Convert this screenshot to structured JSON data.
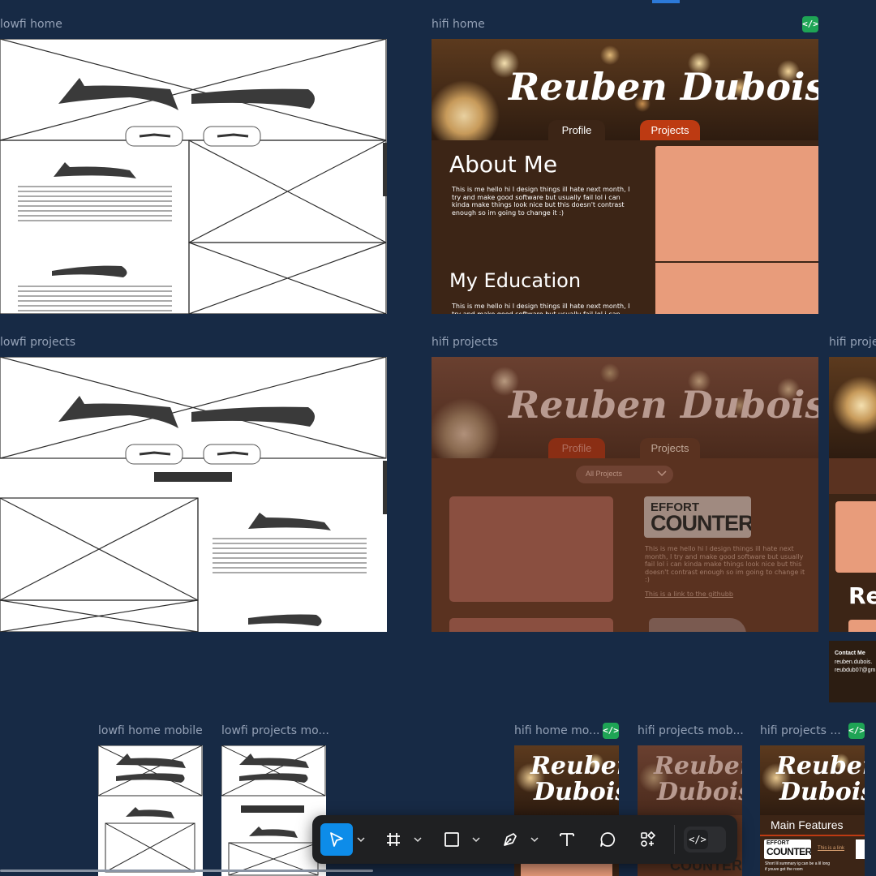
{
  "frames": {
    "lowfi_home": {
      "label": "lowfi home"
    },
    "hifi_home": {
      "label": "hifi home",
      "code_badge": "</>",
      "name": "Reuben Dubois",
      "tab_profile": "Profile",
      "tab_projects": "Projects",
      "about_heading": "About Me",
      "about_text": "This is me hello hi I design things ill hate next month, I try and make good software but usually fail lol i can kinda make things look nice but this doesn't contrast enough so im going to change it :)",
      "education_heading": "My Education",
      "education_text": "This is me hello hi I design things ill hate next month, I try and make good software but usually fail lol i can"
    },
    "lowfi_projects": {
      "label": "lowfi projects"
    },
    "hifi_projects": {
      "label": "hifi projects",
      "name": "Reuben Dubois",
      "tab_profile": "Profile",
      "tab_projects": "Projects",
      "filter_value": "All Projects",
      "logo_line1": "EFFORT",
      "logo_line2": "COUNTER",
      "description": "This is me hello hi I design things ill hate next month, I try and make good software but usually fail lol i can kinda make things look nice but this doesn't contrast enough so im going to change it :)",
      "link_text": "This is a link to the githubb"
    },
    "hifi_projects_partial": {
      "label": "hifi proje",
      "heading_fragment": "Re",
      "contact_heading": "Contact Me",
      "contact_email1": "reuben.dubois.",
      "contact_email2": "reubdub07@gm"
    },
    "lowfi_home_mobile": {
      "label": "lowfi home mobile"
    },
    "lowfi_projects_mobile": {
      "label": "lowfi projects mo..."
    },
    "hifi_home_mobile": {
      "label": "hifi home mo...",
      "code_badge": "</>",
      "name_line1": "Reuben",
      "name_line2": "Dubois"
    },
    "hifi_projects_mobile": {
      "label": "hifi projects mob...",
      "name_line1": "Reuben",
      "name_line2": "Dubois",
      "logo_line2": "COUNTER"
    },
    "hifi_projects_mobile2": {
      "label": "hifi projects ...",
      "code_badge": "</>",
      "name_line1": "Reuben",
      "name_line2": "Dubois",
      "main_features": "Main Features",
      "logo_line1": "EFFORT",
      "logo_line2": "COUNTER",
      "link_text": "This is a link",
      "summary": "Short lil summary ig can be a lil long if youve got the room"
    }
  },
  "toolbar": {
    "tools": [
      {
        "name": "move-tool",
        "icon": "cursor-arrow",
        "active": true
      },
      {
        "name": "frame-tool",
        "icon": "hash-frame"
      },
      {
        "name": "rectangle-tool",
        "icon": "square"
      },
      {
        "name": "pen-tool",
        "icon": "pen-nib"
      },
      {
        "name": "text-tool",
        "icon": "letter-t"
      },
      {
        "name": "comment-tool",
        "icon": "speech-bubble"
      },
      {
        "name": "actions-tool",
        "icon": "shapes-plus"
      },
      {
        "name": "dev-mode-toggle",
        "icon": "code-brackets"
      }
    ],
    "dev_mode_label": "</>"
  },
  "colors": {
    "canvas": "#172a45",
    "hifi_dark": "#3c2516",
    "accent_orange": "#bd3a12",
    "peach": "#e89c7b",
    "tool_active": "#0d8ce9",
    "code_badge": "#1ea455"
  }
}
